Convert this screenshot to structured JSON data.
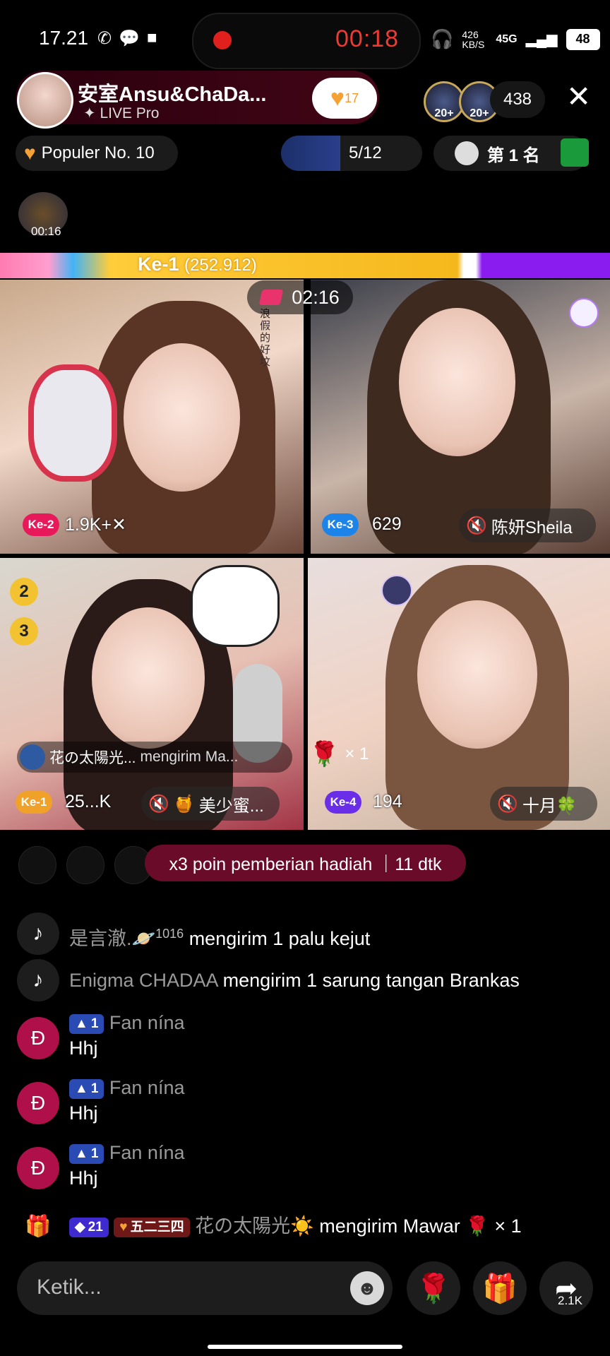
{
  "status": {
    "time": "17.21",
    "rec_timer": "00:18",
    "net_speed": "426 KB/S",
    "network": "45G",
    "battery": "48"
  },
  "host": {
    "name": "安室Ansu&ChaDa...",
    "sub": "LIVE Pro",
    "follow_count": "17",
    "viewer_badges": [
      "20+",
      "20+"
    ],
    "viewer_count": "438"
  },
  "ranking": {
    "populer": "Populer No. 10",
    "match_progress": "5/12",
    "first_place": "第 1 名"
  },
  "bolt_timer": "00:16",
  "score_bar": {
    "label": "Ke-1",
    "value": "(252.912)"
  },
  "battle_timer": "02:16",
  "tiles": [
    {
      "rank": "Ke-2",
      "score": "1.9K+✕",
      "color": "#e8195a"
    },
    {
      "rank": "Ke-3",
      "score": "629",
      "name": "陈妍Sheila",
      "color": "#1c84e8"
    },
    {
      "rank": "Ke-1",
      "score": "25...K",
      "name": "美少蜜...",
      "color": "#f0a12a"
    },
    {
      "rank": "Ke-4",
      "score": "194",
      "name": "十月🍀",
      "color": "#6a2ee8"
    }
  ],
  "tile_vertical_text": "浪假的好坟",
  "gift_notice": {
    "from": "花の太陽光...",
    "verb": "mengirim Ma...",
    "mult": "× 1"
  },
  "rank_icons": [
    "2",
    "3"
  ],
  "banner": "x3 poin pemberian hadiah ｜11 dtk",
  "chat": [
    {
      "icon": "tiktok",
      "user": "是言澈.🪐",
      "sup": "1016",
      "text": "mengirim 1 palu kejut"
    },
    {
      "icon": "tiktok",
      "user": "Enigma CHADAA",
      "text": "mengirim 1 sarung tangan Brankas"
    },
    {
      "icon": "Đ",
      "level": "1",
      "user": "Fan nína",
      "text": "Hhj"
    },
    {
      "icon": "Đ",
      "level": "1",
      "user": "Fan nína",
      "text": "Hhj"
    },
    {
      "icon": "Đ",
      "level": "1",
      "user": "Fan nína",
      "text": "Hhj"
    },
    {
      "icon": "gift",
      "level": "21",
      "fan_badge": "五二三四",
      "user": "花の太陽光☀️",
      "text": "mengirim Mawar 🌹 × 1"
    }
  ],
  "input_placeholder": "Ketik...",
  "share_count": "2.1K",
  "colors": {
    "accent_red": "#ee3b32",
    "banner": "#6b0b2a",
    "level_blue": "#2a4bb3"
  }
}
